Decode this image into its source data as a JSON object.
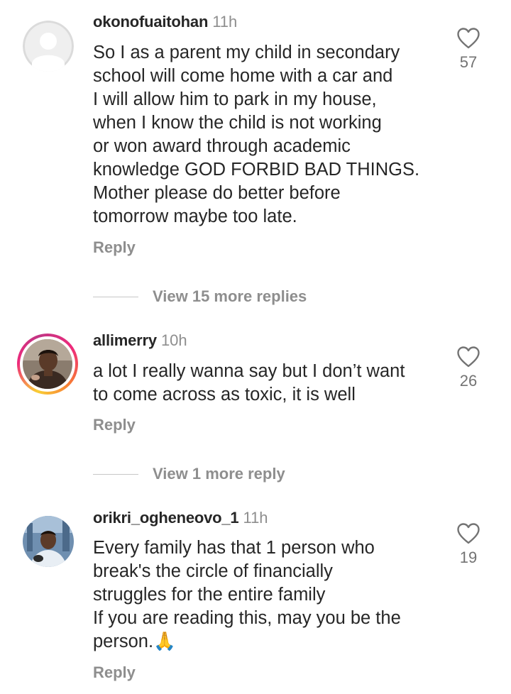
{
  "comments": [
    {
      "username": "okonofuaitohan",
      "time": "11h",
      "text": "So I as a parent my child in secondary\nschool will come home with a car and\nI will allow him to park in my house,\nwhen I know the child is not working\nor won award through academic\nknowledge GOD FORBID BAD THINGS.\nMother please  do better before\ntomorrow maybe too late.",
      "reply_label": "Reply",
      "likes": "57",
      "view_replies": "View 15 more replies",
      "avatar": "default-avatar"
    },
    {
      "username": "allimerry",
      "time": "10h",
      "text": "a lot I really wanna say but I don’t want\nto come across as toxic, it is well",
      "reply_label": "Reply",
      "likes": "26",
      "view_replies": "View 1 more reply",
      "avatar": "photo-avatar-with-story"
    },
    {
      "username": "orikri_ogheneovo_1",
      "time": "11h",
      "text": "Every family has that 1 person who\nbreak's the circle of financially\nstruggles for the entire family\nIf you are reading this, may you be the\nperson.🙏",
      "reply_label": "Reply",
      "likes": "19",
      "avatar": "photo-avatar"
    }
  ],
  "icons": {
    "like": "heart-outline-icon"
  },
  "colors": {
    "text": "#262626",
    "secondary": "#8e8e8e",
    "story_ring": [
      "#f9ce34",
      "#ee2a7b",
      "#c13584"
    ]
  }
}
